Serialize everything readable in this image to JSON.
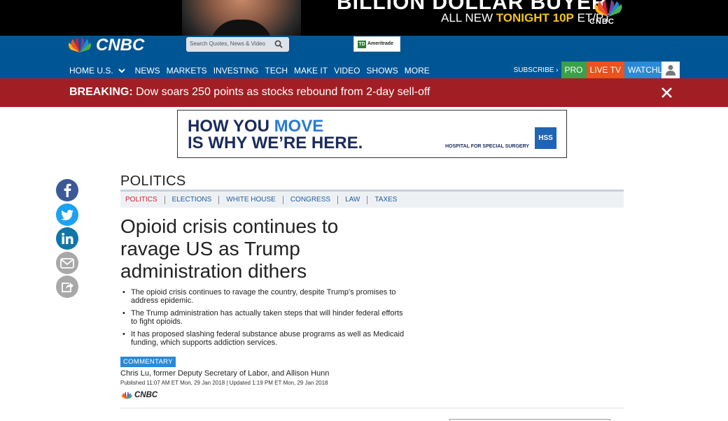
{
  "promo": {
    "headline": "BILLION DOLLAR BUYER",
    "sub_prefix": "ALL NEW ",
    "sub_highlight": "TONIGHT 10P",
    "sub_suffix": " ET/PT",
    "network": "CNBC"
  },
  "header": {
    "logo_text": "CNBC",
    "search_placeholder": "Search Quotes, News & Video",
    "ad_label": "Ameritrade",
    "ad_box": "TD"
  },
  "nav": {
    "items": [
      "HOME U.S.",
      "NEWS",
      "MARKETS",
      "INVESTING",
      "TECH",
      "MAKE IT",
      "VIDEO",
      "SHOWS",
      "MORE"
    ],
    "subscribe": "SUBSCRIBE ›",
    "pro": "PRO",
    "live_tv": "LIVE TV",
    "watchlist": "WATCHLIST"
  },
  "breaking": {
    "label": "BREAKING:",
    "text": "Dow soars 250 points as stocks rebound from 2-day sell-off"
  },
  "ad_hss": {
    "line1_a": "HOW YOU ",
    "line1_b": "MOVE",
    "line2": "IS WHY WE’RE HERE.",
    "brand": "HOSPITAL FOR SPECIAL SURGERY",
    "logo": "HSS"
  },
  "article": {
    "section": "POLITICS",
    "subnav": [
      "POLITICS",
      "ELECTIONS",
      "WHITE HOUSE",
      "CONGRESS",
      "LAW",
      "TAXES"
    ],
    "title": "Opioid crisis continues to ravage US as Trump administration dithers",
    "bullets": [
      "The opioid crisis continues to ravage the country, despite Trump's promises to address epidemic.",
      "The Trump administration has actually taken steps that will hinder federal efforts to fight opioids.",
      "It has proposed slashing federal substance abuse programs as well as Medicaid funding, which supports addiction services."
    ],
    "tag": "COMMENTARY",
    "author": "Chris Lu, former Deputy Secretary of Labor, and Allison Hunn",
    "published": "Published 11:07 AM ET Mon, 29 Jan 2018 | Updated 1:19 PM ET Mon, 29 Jan 2018",
    "source": "CNBC"
  },
  "colors": {
    "header_blue": "#005594",
    "breaking_red": "#a11f24",
    "pro_green": "#3aa04a",
    "live_orange": "#e9531d",
    "watchlist_blue": "#2a8ad6"
  }
}
